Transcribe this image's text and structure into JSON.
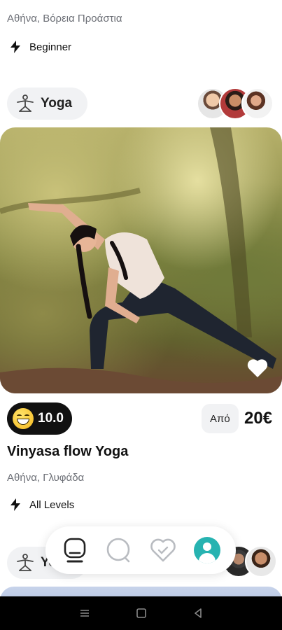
{
  "previous_card": {
    "location": "Αθήνα, Βόρεια Προάστια",
    "level": "Beginner"
  },
  "current_card": {
    "category": "Yoga",
    "rating": "10.0",
    "price_prefix": "Από",
    "price": "20€",
    "title": "Vinyasa flow Yoga",
    "location": "Αθήνα, Γλυφάδα",
    "level": "All Levels"
  },
  "next_card": {
    "category": "Yoga"
  },
  "icons": {
    "level": "lightning-icon",
    "category": "yoga-pose-icon",
    "favorite": "heart-icon",
    "rating_emoji": "grinning-face-icon",
    "nav": [
      "home-icon",
      "search-icon",
      "favorites-heart-icon",
      "profile-avatar-icon"
    ]
  },
  "colors": {
    "accent": "#27b3b1",
    "badge_bg": "#111111",
    "chip_bg": "#f1f2f4",
    "muted_text": "#6c6f76"
  }
}
